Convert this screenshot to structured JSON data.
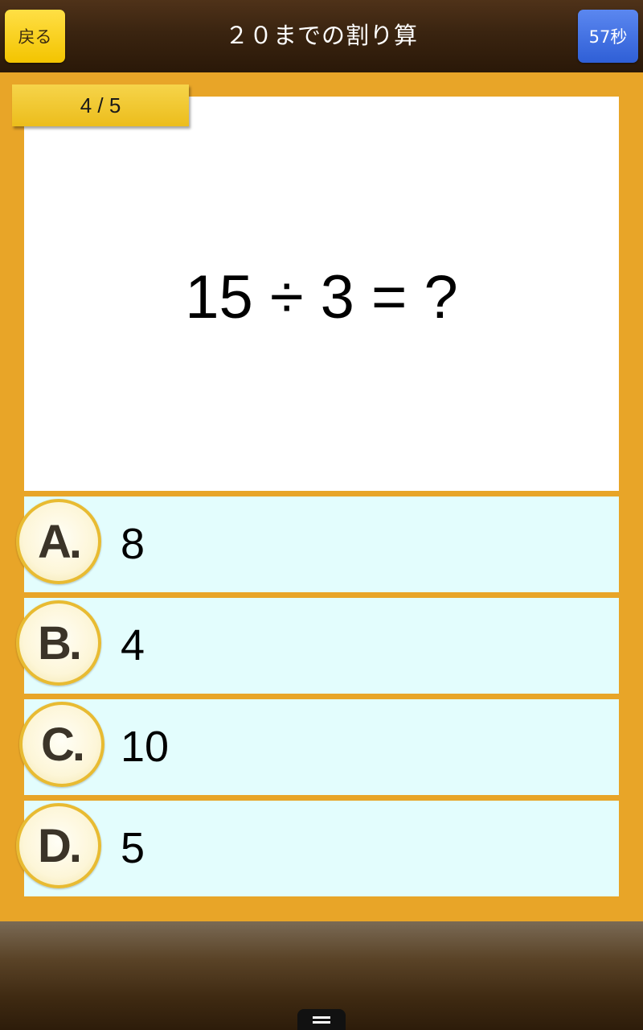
{
  "header": {
    "back_label": "戻る",
    "title": "２０までの割り算",
    "timer": "57秒"
  },
  "question": {
    "progress": "4 / 5",
    "text": "15 ÷ 3 =  ?"
  },
  "answers": [
    {
      "letter": "A.",
      "value": "8"
    },
    {
      "letter": "B.",
      "value": "4"
    },
    {
      "letter": "C.",
      "value": "10"
    },
    {
      "letter": "D.",
      "value": "5"
    }
  ],
  "colors": {
    "background": "#e8a528",
    "answer_bg": "#e3fdfd",
    "back_button": "#f3c400",
    "timer_button": "#2f5fd6"
  },
  "icons": {
    "menu": "menu-icon"
  }
}
